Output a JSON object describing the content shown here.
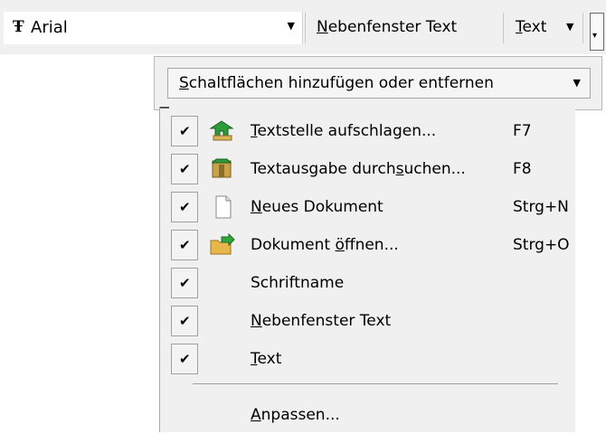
{
  "toolbar": {
    "font_name": "Arial",
    "font_glyph": "Ŧ",
    "side_window_label": "Nebenfenster Text",
    "text_label": "Text"
  },
  "popup": {
    "add_remove_label": "Schaltflächen hinzufügen oder entfernen"
  },
  "menu": {
    "items": [
      {
        "label": "Textstelle aufschlagen...",
        "shortcut": "F7",
        "checked": true,
        "icon": "lookup-passage-icon"
      },
      {
        "label": "Textausgabe durchsuchen...",
        "shortcut": "F8",
        "checked": true,
        "icon": "search-edition-icon"
      },
      {
        "label": "Neues Dokument",
        "shortcut": "Strg+N",
        "checked": true,
        "icon": "new-document-icon"
      },
      {
        "label": "Dokument öffnen...",
        "shortcut": "Strg+O",
        "checked": true,
        "icon": "open-document-icon"
      },
      {
        "label": "Schriftname",
        "shortcut": "",
        "checked": true,
        "icon": ""
      },
      {
        "label": "Nebenfenster Text",
        "shortcut": "",
        "checked": true,
        "icon": ""
      },
      {
        "label": "Text",
        "shortcut": "",
        "checked": true,
        "icon": ""
      }
    ],
    "customize_label": "Anpassen..."
  }
}
